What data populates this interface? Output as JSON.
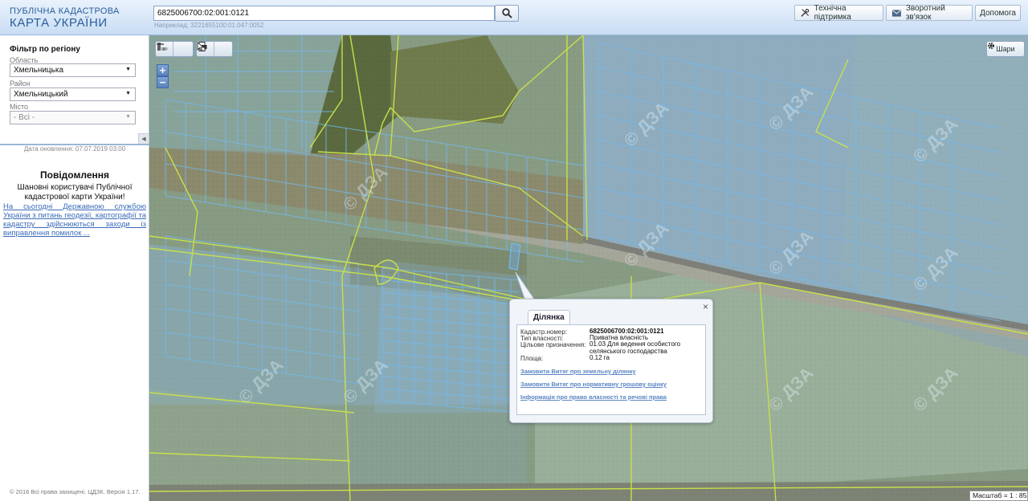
{
  "header": {
    "logo_line1": "ПУБЛІЧНА КАДАСТРОВА",
    "logo_line2": "КАРТА УКРАЇНИ",
    "search_value": "6825006700:02:001:0121",
    "search_hint": "Наприклад: 3221655100:01:047:0052",
    "buttons": {
      "support": "Технічна підтримка",
      "feedback": "Зворотний зв'язок",
      "help": "Допомога"
    }
  },
  "sidebar": {
    "filter_title": "Фільтр по регіону",
    "region_label": "Область",
    "region_value": "Хмельницька",
    "district_label": "Район",
    "district_value": "Хмельницький",
    "city_label": "Місто",
    "city_value": "- Всі -",
    "update_date": "Дата оновлення: 07.07.2019 03:00",
    "message_title": "Повідомлення",
    "message_body": "Шановні користувачі Публічної кадастрової карти України!",
    "message_link": "На сьогодні Державною службою України з питань геодезії, картографії та кадастру здійснюються заходи із виправлення помилок ...",
    "copyright": "© 2016 Всі права захищені. ЦДЗК. Версія 1.17."
  },
  "map": {
    "layers_label": "Шари",
    "zoom_in": "+",
    "zoom_out": "−",
    "scale_text": "Масштаб = 1 : 8531",
    "watermark": "© ДЗА"
  },
  "popup": {
    "tab": "Ділянка",
    "cadastral_label": "Кадастр.номер:",
    "cadastral_value": "6825006700:02:001:0121",
    "ownership_label": "Тип власності:",
    "ownership_value": "Приватна власність",
    "purpose_label": "Цільове призначення:",
    "purpose_value": "01.03 Для ведення особистого селянського господарства",
    "area_label": "Площа:",
    "area_value": "0.12 га",
    "link1": "Замовити Витяг про земельну ділянку",
    "link2": "Замовити Витяг про нормативну грошову оцінку",
    "link3": "Інформація про право власності та речові права"
  },
  "colors": {
    "parcel_outline": "#74b8ec",
    "boundary": "#c8e04a",
    "header_blue": "#2a5d9b"
  }
}
